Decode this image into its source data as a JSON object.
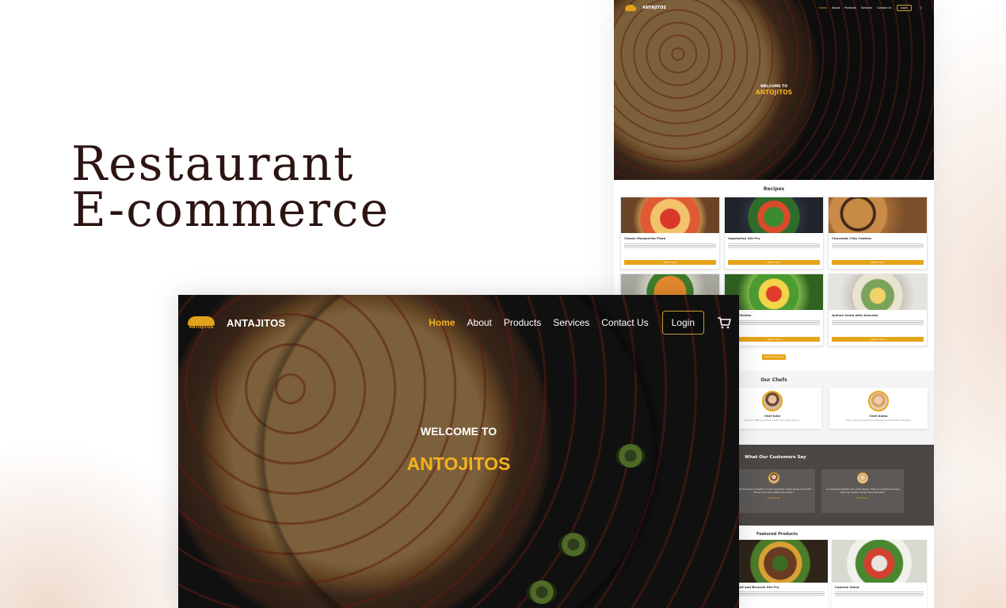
{
  "headline": {
    "line1": "Restaurant",
    "line2": "E-commerce"
  },
  "hero": {
    "brand": "ANTAJITOS",
    "logo_text": "ANTOJITOS",
    "nav": [
      "Home",
      "About",
      "Products",
      "Services",
      "Contact Us"
    ],
    "active_nav": "Home",
    "login_label": "Login",
    "cart_icon": "cart-icon",
    "welcome": "WELCOME TO",
    "title": "ANTOJITOS"
  },
  "mini": {
    "brand": "ANTAJITOS",
    "nav": [
      "Home",
      "About",
      "Products",
      "Services",
      "Contact Us"
    ],
    "login_label": "Login",
    "welcome": "WELCOME TO",
    "title": "ANTOJITOS",
    "recipes_title": "Recipes",
    "recipes": [
      {
        "name": "Classic Margherita Pizza",
        "button": "Add to Cart"
      },
      {
        "name": "Vegetarian Stir-Fry",
        "button": "Add to Cart"
      },
      {
        "name": "Chocolate Chip Cookies",
        "button": "Add to Cart"
      },
      {
        "name": "",
        "button": ""
      },
      {
        "name": "Salsa Chicken",
        "button": "Add to Cart"
      },
      {
        "name": "Quinoa Salad with Avocado",
        "button": "Add to Cart"
      }
    ],
    "view_all_label": "View All Recipes",
    "chefs_title": "Our Chefs",
    "chefs": [
      {
        "name": "Chef John",
        "bio": "Expert in BBQ and grilled recipes with unique flavors."
      },
      {
        "name": "Chef Aisha",
        "bio": "Loves creating wholesome and balanced meals with fresh taste."
      }
    ],
    "testimonials_title": "What Our Customers Say",
    "testimonials": [
      {
        "text": "\"The food was incredible! I loved the Italian pasta recipe from Chef Maria and it was restaurant-quality.\"",
        "name": "Michael B."
      },
      {
        "text": "\"A wonderful website with great design. Easy to navigate and very inspiring recipes. Highly recommended!\"",
        "name": "Emma K."
      }
    ],
    "featured_title": "Featured Products",
    "featured": [
      {
        "name": "Beef and Broccoli Stir-Fry"
      },
      {
        "name": "Caprese Salad"
      }
    ]
  },
  "colors": {
    "accent": "#f3b21e",
    "headline": "#2c1412",
    "testimonials_bg": "#4a4745"
  }
}
